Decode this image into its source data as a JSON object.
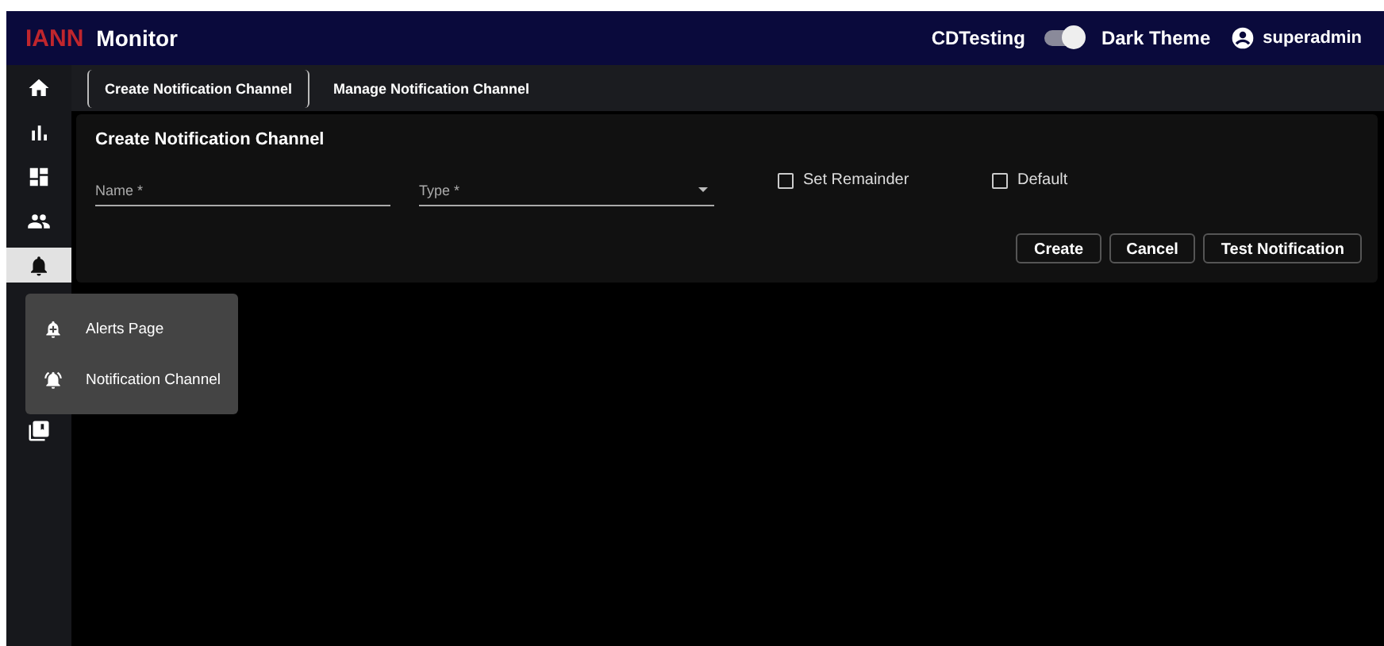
{
  "header": {
    "logo": "IANN",
    "title": "Monitor",
    "environment": "CDTesting",
    "theme_toggle": {
      "label": "Dark Theme",
      "on": true
    },
    "user": "superadmin"
  },
  "sidebar": {
    "items": [
      {
        "kind": "home",
        "selected": false
      },
      {
        "kind": "chart",
        "selected": false
      },
      {
        "kind": "dashboard",
        "selected": false
      },
      {
        "kind": "people",
        "selected": false
      },
      {
        "kind": "bell",
        "selected": true
      },
      {
        "kind": "copy",
        "selected": false
      }
    ]
  },
  "tabs": [
    {
      "label": "Create Notification Channel",
      "selected": true
    },
    {
      "label": "Manage Notification Channel",
      "selected": false
    }
  ],
  "form": {
    "title": "Create Notification Channel",
    "fields": [
      {
        "kind": "text",
        "placeholder": "Name *"
      },
      {
        "kind": "select",
        "placeholder": "Type *"
      }
    ],
    "checkboxes": [
      {
        "label": "Set Remainder",
        "checked": false
      },
      {
        "label": "Default",
        "checked": false
      }
    ],
    "buttons": [
      "Create",
      "Cancel",
      "Test Notification"
    ]
  },
  "menu": {
    "items": [
      {
        "kind": "bell-plus",
        "label": "Alerts Page"
      },
      {
        "kind": "bell-ring",
        "label": "Notification Channel"
      }
    ]
  }
}
